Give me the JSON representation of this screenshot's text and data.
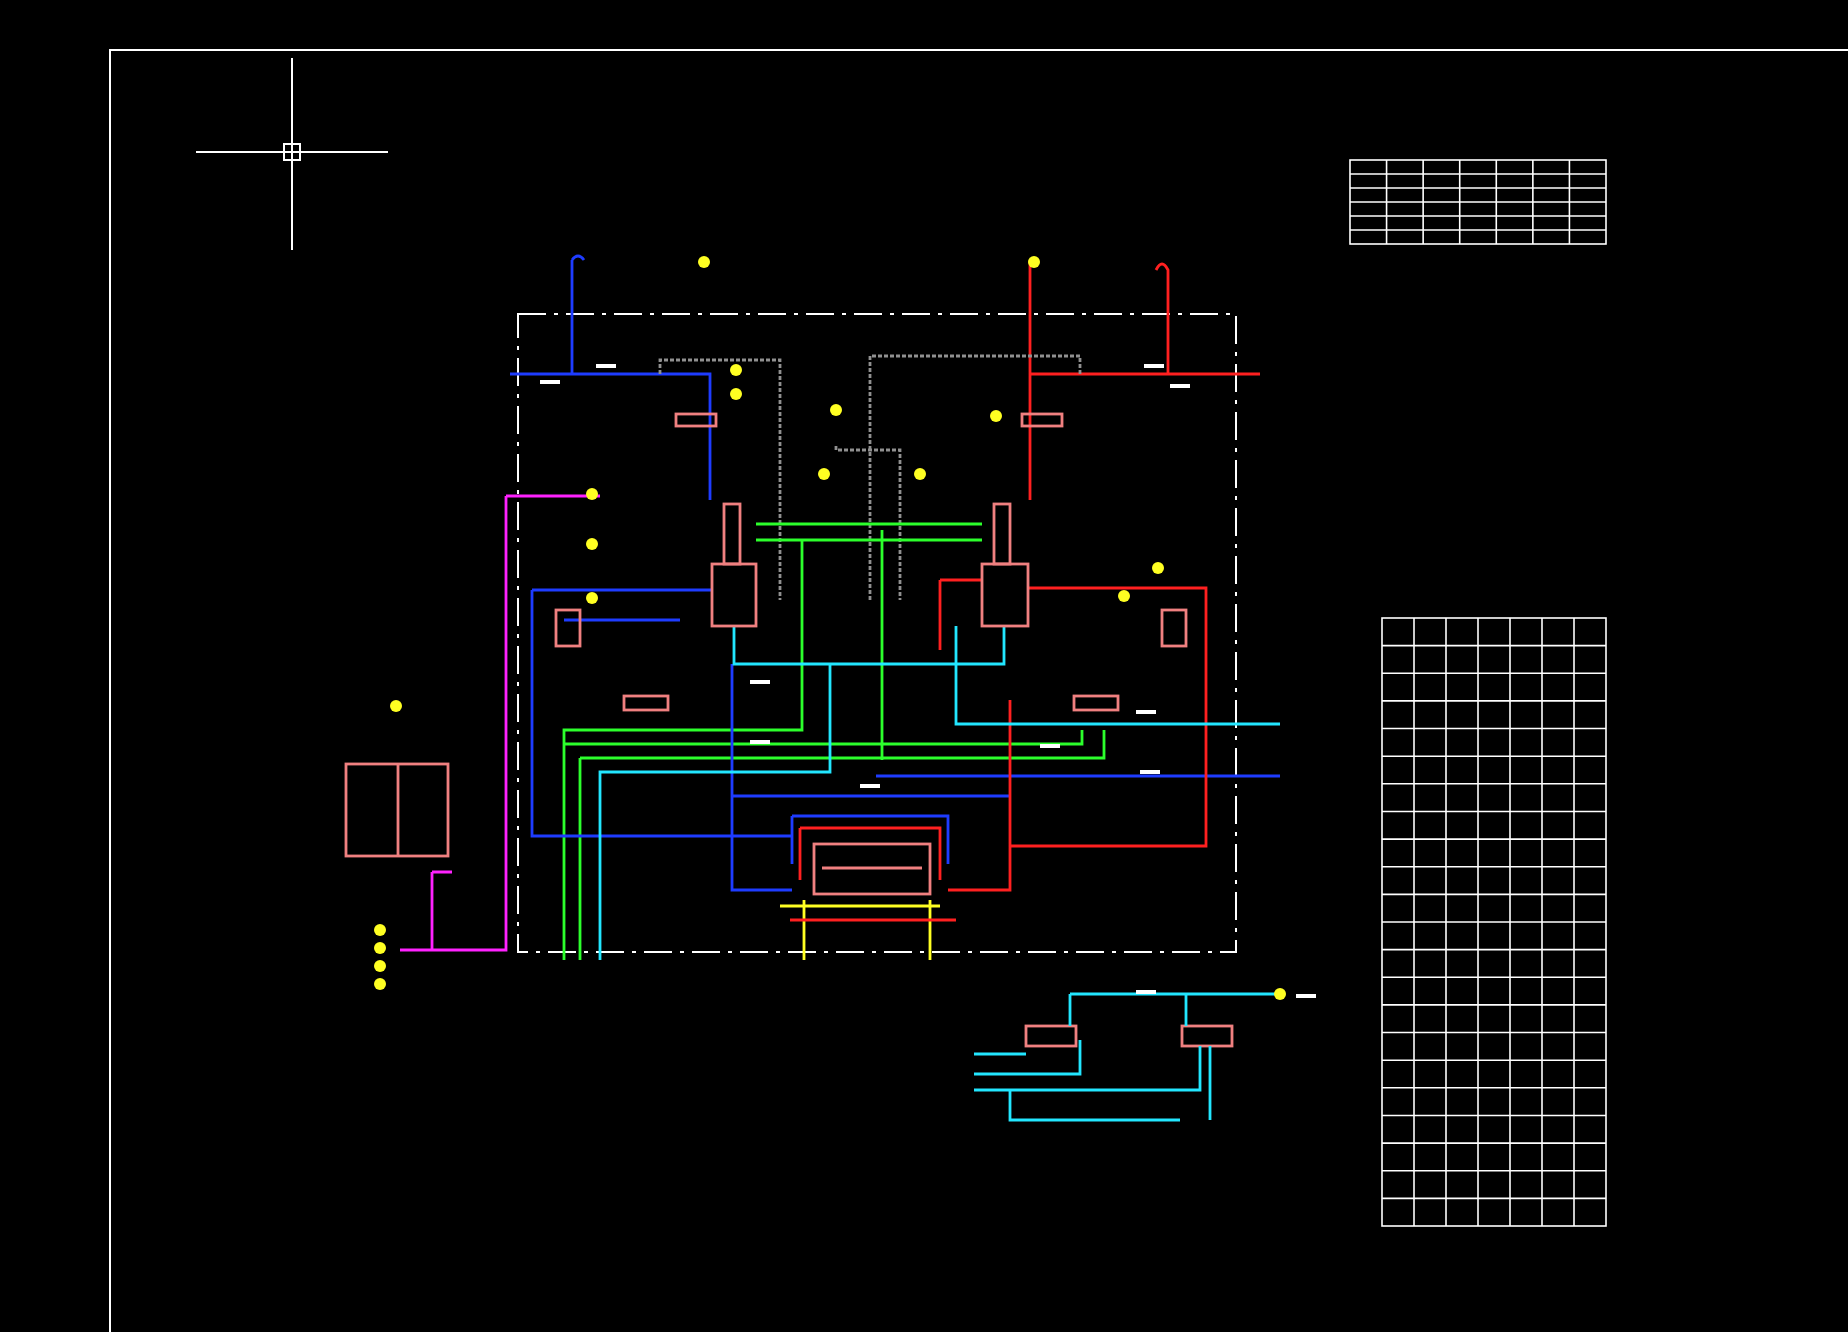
{
  "canvas": {
    "kind": "cad-drawing"
  }
}
